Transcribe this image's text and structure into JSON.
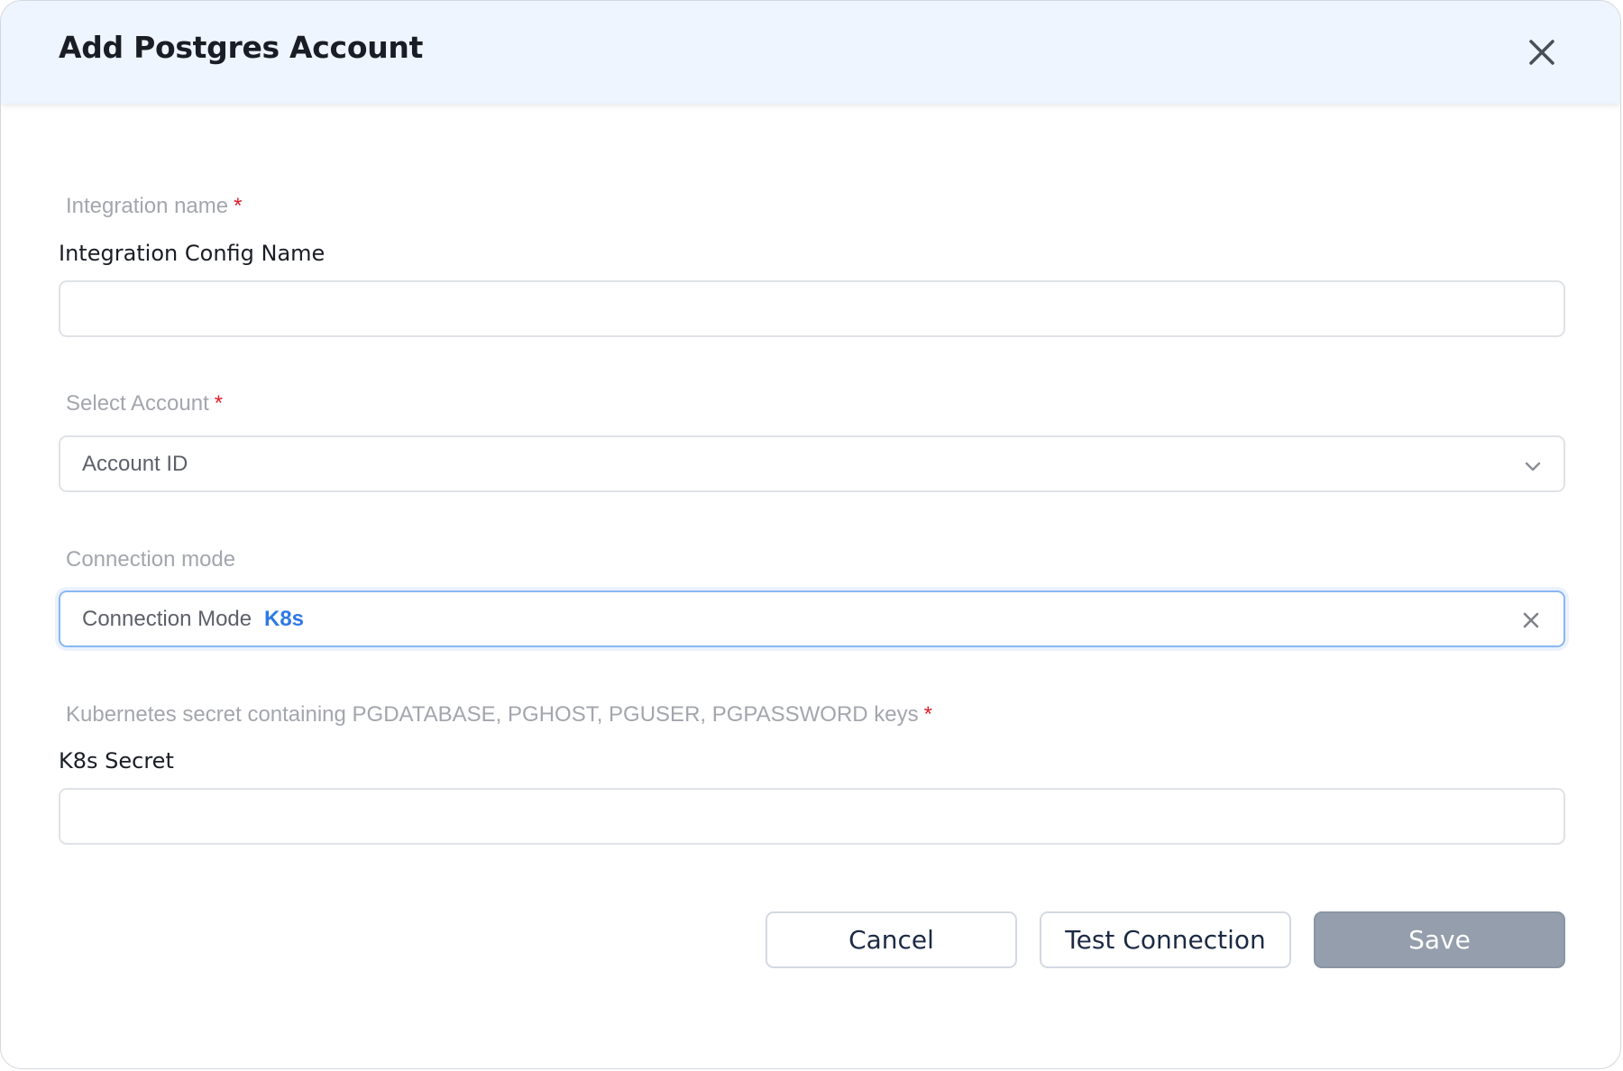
{
  "dialog": {
    "title": "Add Postgres Account"
  },
  "form": {
    "integration_name": {
      "label": "Integration name",
      "required_mark": "*",
      "title": "Integration Config Name",
      "value": "",
      "placeholder": ""
    },
    "account": {
      "label": "Select Account",
      "required_mark": "*",
      "selected": "Account ID"
    },
    "connection_mode": {
      "label": "Connection mode",
      "prefix": "Connection Mode",
      "value": "K8s"
    },
    "k8s_secret": {
      "label": "Kubernetes secret containing PGDATABASE, PGHOST, PGUSER, PGPASSWORD keys",
      "required_mark": "*",
      "title": "K8s Secret",
      "value": "",
      "placeholder": ""
    }
  },
  "actions": {
    "cancel": "Cancel",
    "test_connection": "Test Connection",
    "save": "Save"
  },
  "icons": {
    "close": "close-icon",
    "chevron": "chevron-down-icon",
    "clear": "clear-icon"
  },
  "colors": {
    "header_bg": "#eef5ff",
    "accent": "#2f7ae5",
    "required": "#e11d2b",
    "save_disabled": "#959eac"
  }
}
